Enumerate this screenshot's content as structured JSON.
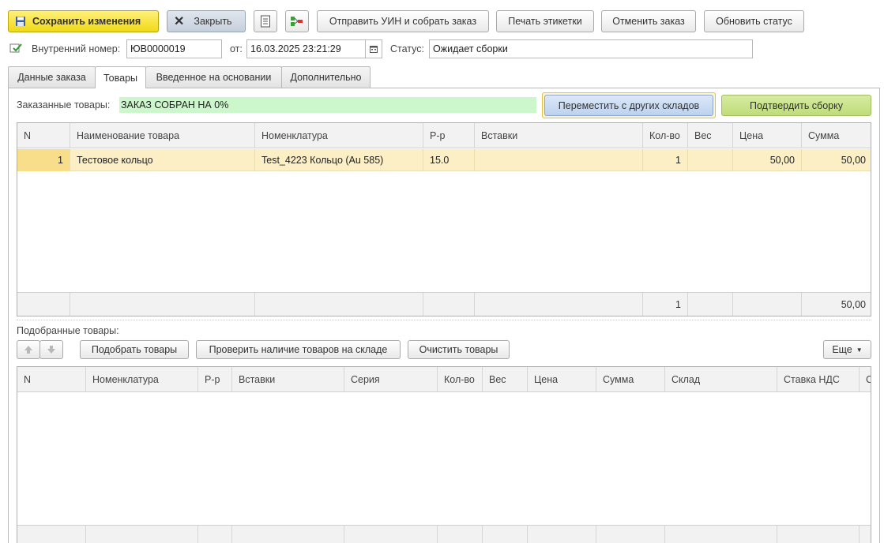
{
  "toolbar": {
    "save_label": "Сохранить изменения",
    "close_label": "Закрыть",
    "send_uin_label": "Отправить УИН и собрать заказ",
    "print_labels_label": "Печать этикетки",
    "cancel_order_label": "Отменить заказ",
    "refresh_status_label": "Обновить статус"
  },
  "header": {
    "internal_number_label": "Внутренний номер:",
    "internal_number_value": "ЮВ0000019",
    "date_label": "от:",
    "date_value": "16.03.2025 23:21:29",
    "status_label": "Статус:",
    "status_value": "Ожидает сборки"
  },
  "tabs": [
    {
      "label": "Данные заказа",
      "active": false
    },
    {
      "label": "Товары",
      "active": true
    },
    {
      "label": "Введенное на основании",
      "active": false
    },
    {
      "label": "Дополнительно",
      "active": false
    }
  ],
  "ordered": {
    "label": "Заказанные товары:",
    "progress_text": "ЗАКАЗ СОБРАН НА 0%",
    "move_button": "Переместить с других складов",
    "confirm_button": "Подтвердить сборку",
    "columns": [
      "N",
      "Наименование товара",
      "Номенклатура",
      "Р-р",
      "Вставки",
      "Кол-во",
      "Вес",
      "Цена",
      "Сумма"
    ],
    "rows": [
      {
        "n": "1",
        "name": "Тестовое кольцо",
        "nomenclature": "Test_4223 Кольцо (Au 585)",
        "size": "15.0",
        "inserts": "",
        "qty": "1",
        "weight": "",
        "price": "50,00",
        "sum": "50,00"
      }
    ],
    "totals": {
      "qty": "1",
      "sum": "50,00"
    }
  },
  "picked": {
    "label": "Подобранные товары:",
    "pick_button": "Подобрать товары",
    "check_button": "Проверить наличие товаров на складе",
    "clear_button": "Очистить товары",
    "more_button": "Еще",
    "columns": [
      "N",
      "Номенклатура",
      "Р-р",
      "Вставки",
      "Серия",
      "Кол-во",
      "Вес",
      "Цена",
      "Сумма",
      "Склад",
      "Ставка НДС",
      "С"
    ]
  },
  "colors": {
    "save_button": "#f1d916",
    "selected_row": "#fcefc5",
    "progress_bg": "#ccf7cc",
    "move_button": "#bcd2ee",
    "confirm_button": "#bfdd79"
  }
}
